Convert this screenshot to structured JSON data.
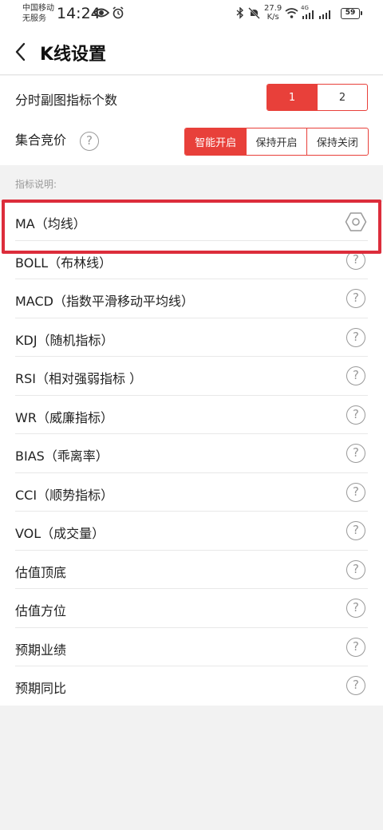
{
  "status_bar": {
    "carrier_line1": "中国移动",
    "carrier_line2": "无服务",
    "time": "14:24",
    "net_speed_value": "27.9",
    "net_speed_unit": "K/s",
    "network": "4G",
    "battery": "59",
    "icons": [
      "eye-icon",
      "alarm-icon",
      "bluetooth-icon",
      "mute-icon",
      "wifi-icon",
      "signal-icon",
      "battery-icon"
    ]
  },
  "header": {
    "back_icon": "chevron-left-icon",
    "title": "K线设置"
  },
  "settings": {
    "sub_chart_count": {
      "label": "分时副图指标个数",
      "options": [
        "1",
        "2"
      ],
      "selected": "1"
    },
    "auction": {
      "label": "集合竞价",
      "help": "?",
      "options": [
        "智能开启",
        "保持开启",
        "保持关闭"
      ],
      "selected": "智能开启"
    }
  },
  "indicators": {
    "section_label": "指标说明:",
    "items": [
      {
        "label": "MA（均线）",
        "icon": "settings-hexagon-icon"
      },
      {
        "label": "BOLL（布林线）",
        "icon": "help-icon"
      },
      {
        "label": "MACD（指数平滑移动平均线）",
        "icon": "help-icon"
      },
      {
        "label": "KDJ（随机指标）",
        "icon": "help-icon"
      },
      {
        "label": "RSI（相对强弱指标 ）",
        "icon": "help-icon"
      },
      {
        "label": "WR（威廉指标）",
        "icon": "help-icon"
      },
      {
        "label": "BIAS（乖离率）",
        "icon": "help-icon"
      },
      {
        "label": "CCI（顺势指标）",
        "icon": "help-icon"
      },
      {
        "label": "VOL（成交量）",
        "icon": "help-icon"
      },
      {
        "label": "估值顶底",
        "icon": "help-icon"
      },
      {
        "label": "估值方位",
        "icon": "help-icon"
      },
      {
        "label": "预期业绩",
        "icon": "help-icon"
      },
      {
        "label": "预期同比",
        "icon": "help-icon"
      }
    ],
    "help_glyph": "?"
  },
  "colors": {
    "accent": "#e8403a",
    "highlight_box": "#dc2d3b",
    "background": "#f2f2f2"
  }
}
